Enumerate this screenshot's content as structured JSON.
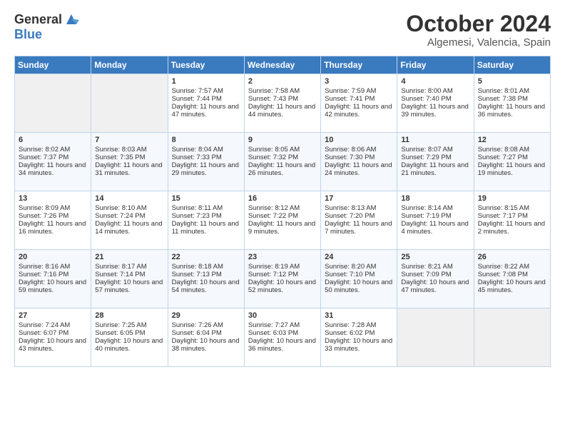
{
  "header": {
    "logo_general": "General",
    "logo_blue": "Blue",
    "month_title": "October 2024",
    "location": "Algemesi, Valencia, Spain"
  },
  "weekdays": [
    "Sunday",
    "Monday",
    "Tuesday",
    "Wednesday",
    "Thursday",
    "Friday",
    "Saturday"
  ],
  "weeks": [
    [
      {
        "day": "",
        "info": ""
      },
      {
        "day": "",
        "info": ""
      },
      {
        "day": "1",
        "info": "Sunrise: 7:57 AM\nSunset: 7:44 PM\nDaylight: 11 hours and 47 minutes."
      },
      {
        "day": "2",
        "info": "Sunrise: 7:58 AM\nSunset: 7:43 PM\nDaylight: 11 hours and 44 minutes."
      },
      {
        "day": "3",
        "info": "Sunrise: 7:59 AM\nSunset: 7:41 PM\nDaylight: 11 hours and 42 minutes."
      },
      {
        "day": "4",
        "info": "Sunrise: 8:00 AM\nSunset: 7:40 PM\nDaylight: 11 hours and 39 minutes."
      },
      {
        "day": "5",
        "info": "Sunrise: 8:01 AM\nSunset: 7:38 PM\nDaylight: 11 hours and 36 minutes."
      }
    ],
    [
      {
        "day": "6",
        "info": "Sunrise: 8:02 AM\nSunset: 7:37 PM\nDaylight: 11 hours and 34 minutes."
      },
      {
        "day": "7",
        "info": "Sunrise: 8:03 AM\nSunset: 7:35 PM\nDaylight: 11 hours and 31 minutes."
      },
      {
        "day": "8",
        "info": "Sunrise: 8:04 AM\nSunset: 7:33 PM\nDaylight: 11 hours and 29 minutes."
      },
      {
        "day": "9",
        "info": "Sunrise: 8:05 AM\nSunset: 7:32 PM\nDaylight: 11 hours and 26 minutes."
      },
      {
        "day": "10",
        "info": "Sunrise: 8:06 AM\nSunset: 7:30 PM\nDaylight: 11 hours and 24 minutes."
      },
      {
        "day": "11",
        "info": "Sunrise: 8:07 AM\nSunset: 7:29 PM\nDaylight: 11 hours and 21 minutes."
      },
      {
        "day": "12",
        "info": "Sunrise: 8:08 AM\nSunset: 7:27 PM\nDaylight: 11 hours and 19 minutes."
      }
    ],
    [
      {
        "day": "13",
        "info": "Sunrise: 8:09 AM\nSunset: 7:26 PM\nDaylight: 11 hours and 16 minutes."
      },
      {
        "day": "14",
        "info": "Sunrise: 8:10 AM\nSunset: 7:24 PM\nDaylight: 11 hours and 14 minutes."
      },
      {
        "day": "15",
        "info": "Sunrise: 8:11 AM\nSunset: 7:23 PM\nDaylight: 11 hours and 11 minutes."
      },
      {
        "day": "16",
        "info": "Sunrise: 8:12 AM\nSunset: 7:22 PM\nDaylight: 11 hours and 9 minutes."
      },
      {
        "day": "17",
        "info": "Sunrise: 8:13 AM\nSunset: 7:20 PM\nDaylight: 11 hours and 7 minutes."
      },
      {
        "day": "18",
        "info": "Sunrise: 8:14 AM\nSunset: 7:19 PM\nDaylight: 11 hours and 4 minutes."
      },
      {
        "day": "19",
        "info": "Sunrise: 8:15 AM\nSunset: 7:17 PM\nDaylight: 11 hours and 2 minutes."
      }
    ],
    [
      {
        "day": "20",
        "info": "Sunrise: 8:16 AM\nSunset: 7:16 PM\nDaylight: 10 hours and 59 minutes."
      },
      {
        "day": "21",
        "info": "Sunrise: 8:17 AM\nSunset: 7:14 PM\nDaylight: 10 hours and 57 minutes."
      },
      {
        "day": "22",
        "info": "Sunrise: 8:18 AM\nSunset: 7:13 PM\nDaylight: 10 hours and 54 minutes."
      },
      {
        "day": "23",
        "info": "Sunrise: 8:19 AM\nSunset: 7:12 PM\nDaylight: 10 hours and 52 minutes."
      },
      {
        "day": "24",
        "info": "Sunrise: 8:20 AM\nSunset: 7:10 PM\nDaylight: 10 hours and 50 minutes."
      },
      {
        "day": "25",
        "info": "Sunrise: 8:21 AM\nSunset: 7:09 PM\nDaylight: 10 hours and 47 minutes."
      },
      {
        "day": "26",
        "info": "Sunrise: 8:22 AM\nSunset: 7:08 PM\nDaylight: 10 hours and 45 minutes."
      }
    ],
    [
      {
        "day": "27",
        "info": "Sunrise: 7:24 AM\nSunset: 6:07 PM\nDaylight: 10 hours and 43 minutes."
      },
      {
        "day": "28",
        "info": "Sunrise: 7:25 AM\nSunset: 6:05 PM\nDaylight: 10 hours and 40 minutes."
      },
      {
        "day": "29",
        "info": "Sunrise: 7:26 AM\nSunset: 6:04 PM\nDaylight: 10 hours and 38 minutes."
      },
      {
        "day": "30",
        "info": "Sunrise: 7:27 AM\nSunset: 6:03 PM\nDaylight: 10 hours and 36 minutes."
      },
      {
        "day": "31",
        "info": "Sunrise: 7:28 AM\nSunset: 6:02 PM\nDaylight: 10 hours and 33 minutes."
      },
      {
        "day": "",
        "info": ""
      },
      {
        "day": "",
        "info": ""
      }
    ]
  ]
}
